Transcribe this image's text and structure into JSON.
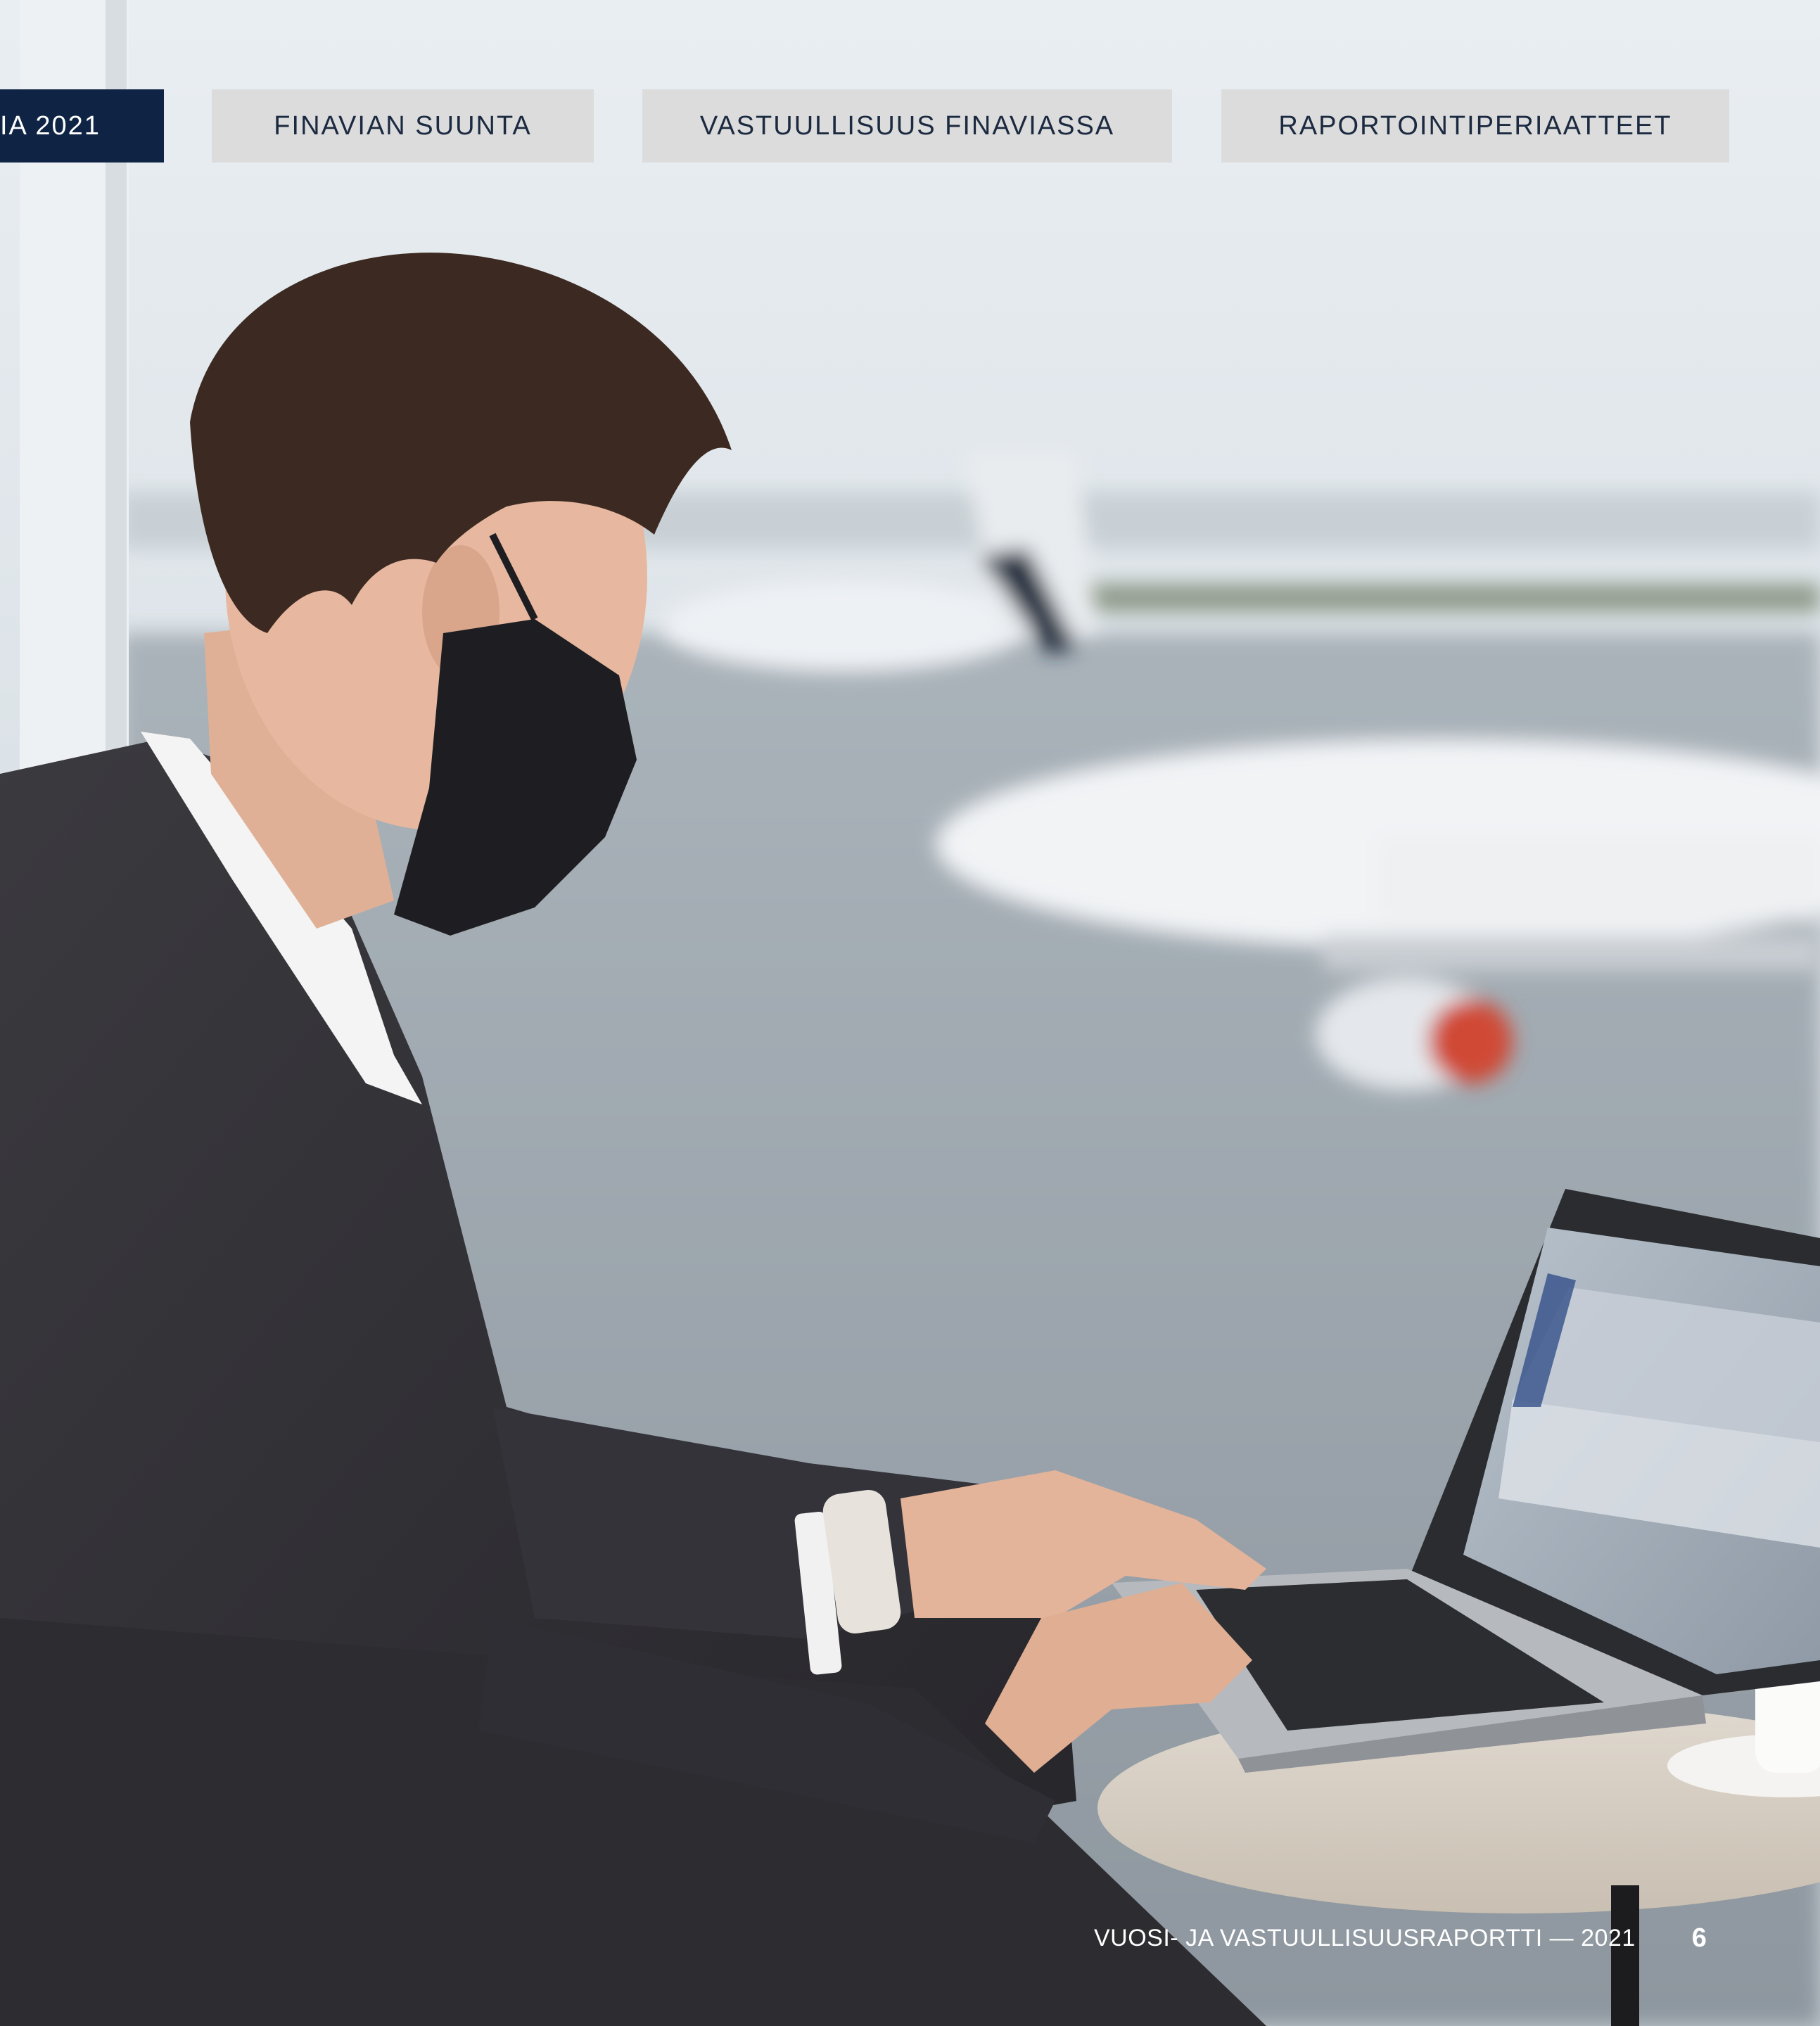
{
  "nav": {
    "tabs": [
      {
        "label": "IA 2021",
        "active": true
      },
      {
        "label": "FINAVIAN SUUNTA",
        "active": false
      },
      {
        "label": "VASTUULLISUUS FINAVIASSA",
        "active": false
      },
      {
        "label": "RAPORTOINTIPERIAATTEET",
        "active": false
      }
    ]
  },
  "photo": {
    "subject": "man in mask working on laptop at airport window"
  },
  "footer": {
    "report_title": "VUOSI- JA VASTUULLISUUSRAPORTTI — 2021",
    "page_number": "6"
  },
  "colors": {
    "active_tab": "#0f2444",
    "inactive_tab": "#dcdcdc",
    "tab_text": "#1b2a40",
    "footer_text": "#ffffff"
  }
}
